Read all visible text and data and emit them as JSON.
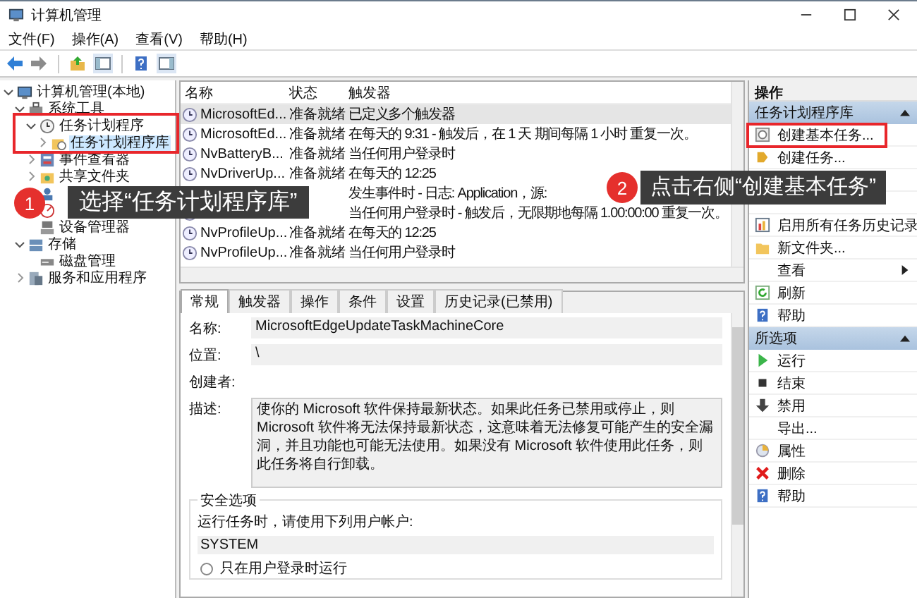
{
  "window": {
    "title": "计算机管理"
  },
  "menu": [
    {
      "label": "文件(F)"
    },
    {
      "label": "操作(A)"
    },
    {
      "label": "查看(V)"
    },
    {
      "label": "帮助(H)"
    }
  ],
  "tree": [
    {
      "label": "计算机管理(本地)",
      "kind": "computer",
      "selected": false,
      "expanded": true,
      "children": [
        {
          "label": "系统工具",
          "kind": "tools",
          "selected": false,
          "expanded": true,
          "children": [
            {
              "label": "任务计划程序",
              "kind": "scheduler",
              "selected": false,
              "expanded": true,
              "children": [
                {
                  "label": "任务计划程序库",
                  "kind": "library",
                  "selected": true,
                  "expanded": false
                }
              ]
            },
            {
              "label": "事件查看器",
              "kind": "events",
              "selected": false,
              "expanded": false
            },
            {
              "label": "共享文件夹",
              "kind": "share",
              "selected": false,
              "expanded": false
            },
            {
              "kind": "users"
            },
            {
              "kind": "performance"
            },
            {
              "label": "设备管理器",
              "kind": "devices",
              "selected": false
            }
          ]
        },
        {
          "label": "存储",
          "kind": "storage",
          "selected": false,
          "expanded": true,
          "children": [
            {
              "label": "磁盘管理",
              "kind": "disk",
              "selected": false
            }
          ]
        },
        {
          "label": "服务和应用程序",
          "kind": "services",
          "selected": false,
          "expanded": false
        }
      ]
    }
  ],
  "tasks": {
    "columns": [
      "名称",
      "状态",
      "触发器"
    ],
    "rows": [
      {
        "name": "MicrosoftEd...",
        "status": "准备就绪",
        "trigger": "已定义多个触发器",
        "selected": true
      },
      {
        "name": "MicrosoftEd...",
        "status": "准备就绪",
        "trigger": "在每天的 9:31 - 触发后，在 1 天 期间每隔 1 小时 重复一次。",
        "selected": false
      },
      {
        "name": "NvBatteryB...",
        "status": "准备就绪",
        "trigger": "当任何用户登录时",
        "selected": false
      },
      {
        "name": "NvDriverUp...",
        "status": "准备就绪",
        "trigger": "在每天的 12:25",
        "selected": false
      },
      {
        "trigger": "发生事件时 - 日志: Application，源:",
        "selected": false
      },
      {
        "trigger": "当任何用户登录时 - 触发后，无限期地每隔 1.00:00:00 重复一次。",
        "selected": false
      },
      {
        "name": "NvProfileUp...",
        "status": "准备就绪",
        "trigger": "在每天的 12:25",
        "selected": false
      },
      {
        "name": "NvProfileUp...",
        "status": "准备就绪",
        "trigger": "当任何用户登录时",
        "selected": false
      }
    ]
  },
  "details": {
    "tabs": [
      {
        "label": "常规",
        "selected": true
      },
      {
        "label": "触发器",
        "selected": false
      },
      {
        "label": "操作",
        "selected": false
      },
      {
        "label": "条件",
        "selected": false
      },
      {
        "label": "设置",
        "selected": false
      },
      {
        "label": "历史记录(已禁用)",
        "selected": false
      }
    ],
    "fields": [
      {
        "label": "名称:",
        "kind": "field",
        "value": "MicrosoftEdgeUpdateTaskMachineCore"
      },
      {
        "label": "位置:",
        "kind": "field",
        "value": "\\"
      },
      {
        "label": "创建者:",
        "kind": "plain"
      },
      {
        "label": "描述:",
        "kind": "area",
        "value": "使你的 Microsoft 软件保持最新状态。如果此任务已禁用或停止，则 Microsoft 软件将无法保持最新状态，这意味着无法修复可能产生的安全漏洞，并且功能也可能无法使用。如果没有 Microsoft 软件使用此任务，则此任务将自行卸载。"
      }
    ],
    "security": {
      "title": "安全选项",
      "prompt": "运行任务时，请使用下列用户帐户:",
      "account": "SYSTEM",
      "options": [
        {
          "label": "只在用户登录时运行",
          "selected": false
        }
      ]
    }
  },
  "actions": {
    "title": "操作",
    "sections": [
      {
        "title": "任务计划程序库",
        "expanded": true,
        "items": [
          {
            "label": "创建基本任务...",
            "kind": "wizard"
          },
          {
            "label": "创建任务...",
            "kind": "task"
          },
          {
            "kind": "covered"
          },
          {
            "kind": "covered"
          },
          {
            "label": "启用所有任务历史记录",
            "kind": "history"
          },
          {
            "label": "新文件夹...",
            "kind": "folder"
          },
          {
            "label": "查看",
            "kind": "submenu"
          },
          {
            "label": "刷新",
            "kind": "refresh"
          },
          {
            "label": "帮助",
            "kind": "help"
          }
        ]
      },
      {
        "title": "所选项",
        "expanded": true,
        "items": [
          {
            "label": "运行",
            "kind": "run"
          },
          {
            "label": "结束",
            "kind": "stop"
          },
          {
            "label": "禁用",
            "kind": "disable"
          },
          {
            "label": "导出...",
            "kind": "plain"
          },
          {
            "label": "属性",
            "kind": "properties"
          },
          {
            "label": "删除",
            "kind": "delete"
          },
          {
            "label": "帮助",
            "kind": "help"
          }
        ]
      }
    ]
  },
  "callouts": [
    {
      "number": "1",
      "text": "选择“任务计划程序库”"
    },
    {
      "number": "2",
      "text": "点击右侧“创建基本任务”"
    }
  ]
}
